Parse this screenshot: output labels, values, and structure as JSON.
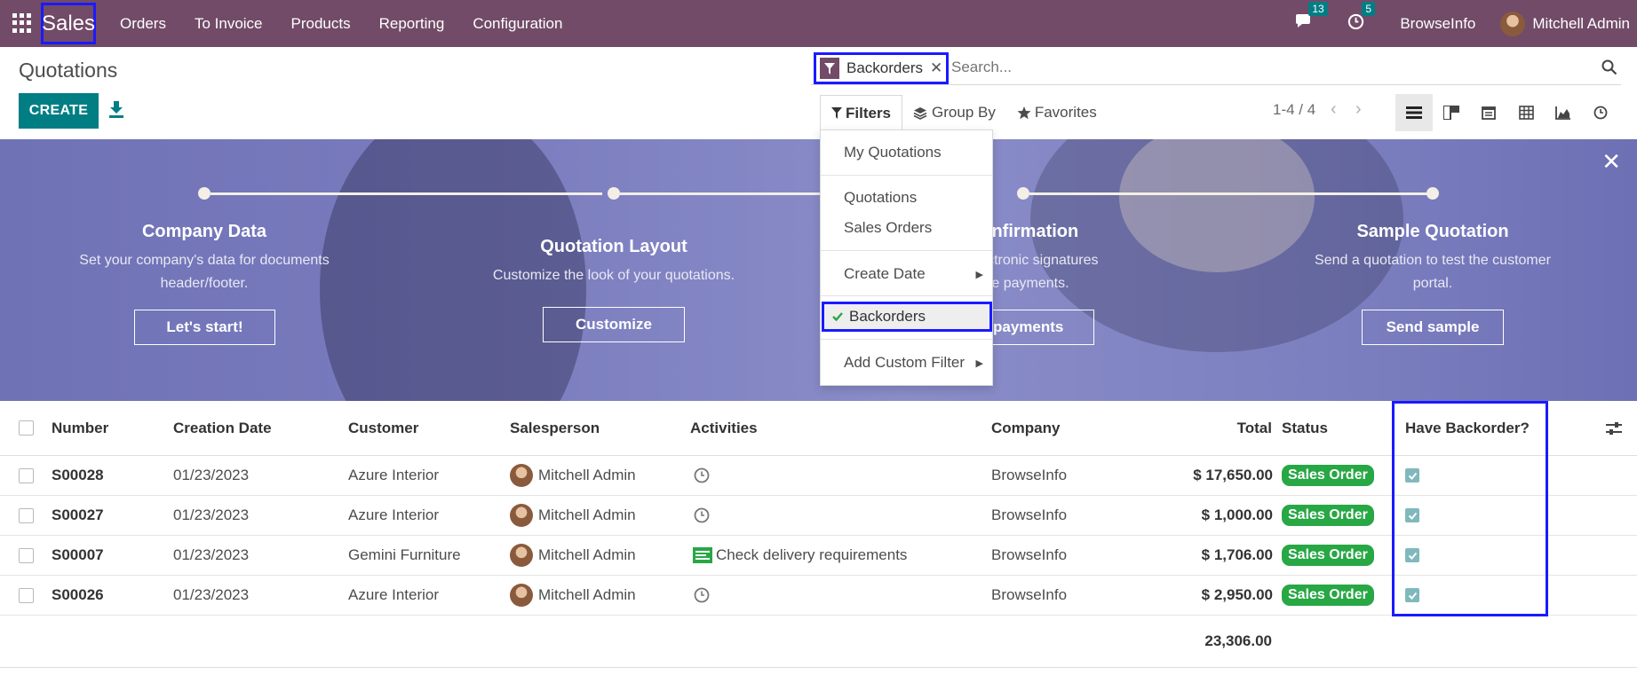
{
  "navbar": {
    "app_name": "Sales",
    "menu": [
      "Orders",
      "To Invoice",
      "Products",
      "Reporting",
      "Configuration"
    ],
    "messages_count": "13",
    "activities_count": "5",
    "company": "BrowseInfo",
    "user": "Mitchell Admin",
    "bg_color": "#714b67"
  },
  "control_panel": {
    "title": "Quotations",
    "create_label": "CREATE",
    "facet_label": "Backorders",
    "search_placeholder": "Search...",
    "filters_label": "Filters",
    "groupby_label": "Group By",
    "favorites_label": "Favorites",
    "pager": "1-4 / 4"
  },
  "filter_dropdown": {
    "items": [
      "My Quotations",
      "Quotations",
      "Sales Orders",
      "Create Date",
      "Backorders",
      "Add Custom Filter"
    ],
    "selected": "Backorders"
  },
  "banner": {
    "steps": [
      {
        "title": "Company Data",
        "desc_line1": "Set your company's data for documents",
        "desc_line2": "header/footer.",
        "button": "Let's start!"
      },
      {
        "title": "Quotation Layout",
        "desc_line1": "Customize the look of your quotations.",
        "desc_line2": "",
        "button": "Customize"
      },
      {
        "title": "Confirmation",
        "desc_line1": "en electronic signatures",
        "desc_line2": "line payments.",
        "button": "t payments"
      },
      {
        "title": "Sample Quotation",
        "desc_line1": "Send a quotation to test the customer",
        "desc_line2": "portal.",
        "button": "Send sample"
      }
    ]
  },
  "table": {
    "columns": [
      "Number",
      "Creation Date",
      "Customer",
      "Salesperson",
      "Activities",
      "Company",
      "Total",
      "Status",
      "Have Backorder?"
    ],
    "rows": [
      {
        "number": "S00028",
        "date": "01/23/2023",
        "customer": "Azure Interior",
        "salesperson": "Mitchell Admin",
        "activity": "",
        "company": "BrowseInfo",
        "total": "$ 17,650.00",
        "status": "Sales Order",
        "backorder": true
      },
      {
        "number": "S00027",
        "date": "01/23/2023",
        "customer": "Azure Interior",
        "salesperson": "Mitchell Admin",
        "activity": "",
        "company": "BrowseInfo",
        "total": "$ 1,000.00",
        "status": "Sales Order",
        "backorder": true
      },
      {
        "number": "S00007",
        "date": "01/23/2023",
        "customer": "Gemini Furniture",
        "salesperson": "Mitchell Admin",
        "activity": "Check delivery requirements",
        "company": "BrowseInfo",
        "total": "$ 1,706.00",
        "status": "Sales Order",
        "backorder": true
      },
      {
        "number": "S00026",
        "date": "01/23/2023",
        "customer": "Azure Interior",
        "salesperson": "Mitchell Admin",
        "activity": "",
        "company": "BrowseInfo",
        "total": "$ 2,950.00",
        "status": "Sales Order",
        "backorder": true
      }
    ],
    "grand_total": "23,306.00"
  },
  "colors": {
    "primary": "#017e84",
    "status_green": "#28a745",
    "highlight_border": "#1a1aff"
  }
}
